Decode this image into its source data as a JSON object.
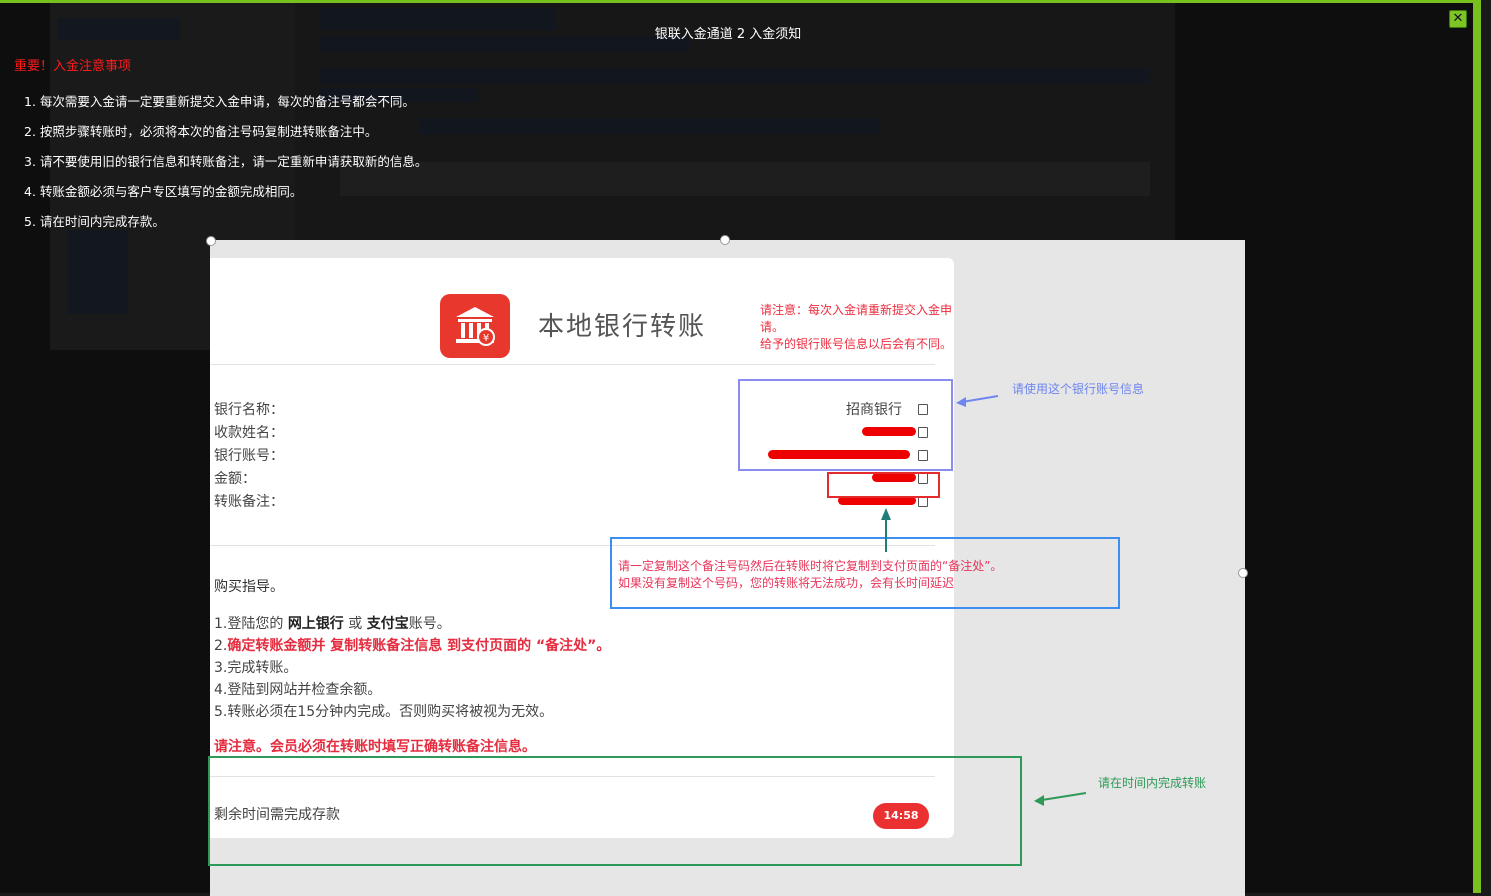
{
  "modal": {
    "title": "银联入金通道 2 入金须知",
    "close_label": "✕"
  },
  "notice": {
    "heading": "重要！入金注意事项",
    "items": [
      "1. 每次需要入金请一定要重新提交入金申请，每次的备注号都会不同。",
      "2. 按照步骤转账时，必须将本次的备注号码复制进转账备注中。",
      "3. 请不要使用旧的银行信息和转账备注，请一定重新申请获取新的信息。",
      "4. 转账金额必须与客户专区填写的金额完成相同。",
      "5. 请在时间内完成存款。"
    ]
  },
  "screenshot": {
    "title": "本地银行转账",
    "warning_line1": "请注意：每次入金请重新提交入金申请。",
    "warning_line2": "给予的银行账号信息以后会有不同。",
    "labels": {
      "bank_name": "银行名称：",
      "account_name": "收款姓名：",
      "account_no": "银行账号：",
      "amount": "金额：",
      "remark": "转账备注："
    },
    "bank_value": "招商银行",
    "bank_info_note": "请使用这个银行账号信息",
    "callout_line1": "请一定复制这个备注号码然后在转账时将它复制到支付页面的“备注处”。",
    "callout_line2": "如果没有复制这个号码，您的转账将无法成功，会有长时间延迟",
    "guide_title": "购买指导。",
    "guide_1_prefix": "1.登陆您的 ",
    "guide_1_bank": "网上银行",
    "guide_1_or": " 或 ",
    "guide_1_alipay": "支付宝",
    "guide_1_suffix": "账号。",
    "guide_2_prefix": "2.",
    "guide_2_red": "确定转账金额并 复制转账备注信息 到支付页面的 “备注处”。",
    "guide_3": "3.完成转账。",
    "guide_4": "4.登陆到网站并检查余额。",
    "guide_5": "5.转账必须在15分钟内完成。否则购买将被视为无效。",
    "member_warning": "请注意。会员必须在转账时填写正确转账备注信息。",
    "remaining_label": "剩余时间需完成存款",
    "timer": "14:58",
    "time_note": "请在时间内完成转账"
  },
  "colors": {
    "modal_border": "#78c01e",
    "notice_heading": "#ff1a1a",
    "timer_bg": "#ea3030"
  }
}
